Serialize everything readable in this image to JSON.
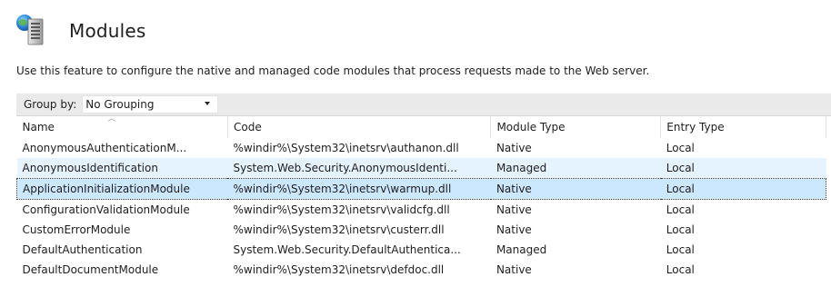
{
  "header": {
    "title": "Modules",
    "icon": "modules-icon"
  },
  "description": "Use this feature to configure the native and managed code modules that process requests made to the Web server.",
  "toolbar": {
    "group_by_label": "Group by:",
    "group_by_value": "No Grouping"
  },
  "table": {
    "columns": [
      "Name",
      "Code",
      "Module Type",
      "Entry Type"
    ],
    "sorted_column": "Name",
    "rows": [
      {
        "name": "AnonymousAuthenticationM...",
        "code": "%windir%\\System32\\inetsrv\\authanon.dll",
        "type": "Native",
        "entry": "Local",
        "state": "normal"
      },
      {
        "name": "AnonymousIdentification",
        "code": "System.Web.Security.AnonymousIdenti...",
        "type": "Managed",
        "entry": "Local",
        "state": "hover"
      },
      {
        "name": "ApplicationInitializationModule",
        "code": "%windir%\\System32\\inetsrv\\warmup.dll",
        "type": "Native",
        "entry": "Local",
        "state": "selected"
      },
      {
        "name": "ConfigurationValidationModule",
        "code": "%windir%\\System32\\inetsrv\\validcfg.dll",
        "type": "Native",
        "entry": "Local",
        "state": "normal"
      },
      {
        "name": "CustomErrorModule",
        "code": "%windir%\\System32\\inetsrv\\custerr.dll",
        "type": "Native",
        "entry": "Local",
        "state": "normal"
      },
      {
        "name": "DefaultAuthentication",
        "code": "System.Web.Security.DefaultAuthentica...",
        "type": "Managed",
        "entry": "Local",
        "state": "normal"
      },
      {
        "name": "DefaultDocumentModule",
        "code": "%windir%\\System32\\inetsrv\\defdoc.dll",
        "type": "Native",
        "entry": "Local",
        "state": "normal"
      }
    ]
  },
  "colors": {
    "selected_row": "#cce8ff",
    "hover_row": "#e5f3ff",
    "toolbar_bg": "#eaeaea"
  }
}
